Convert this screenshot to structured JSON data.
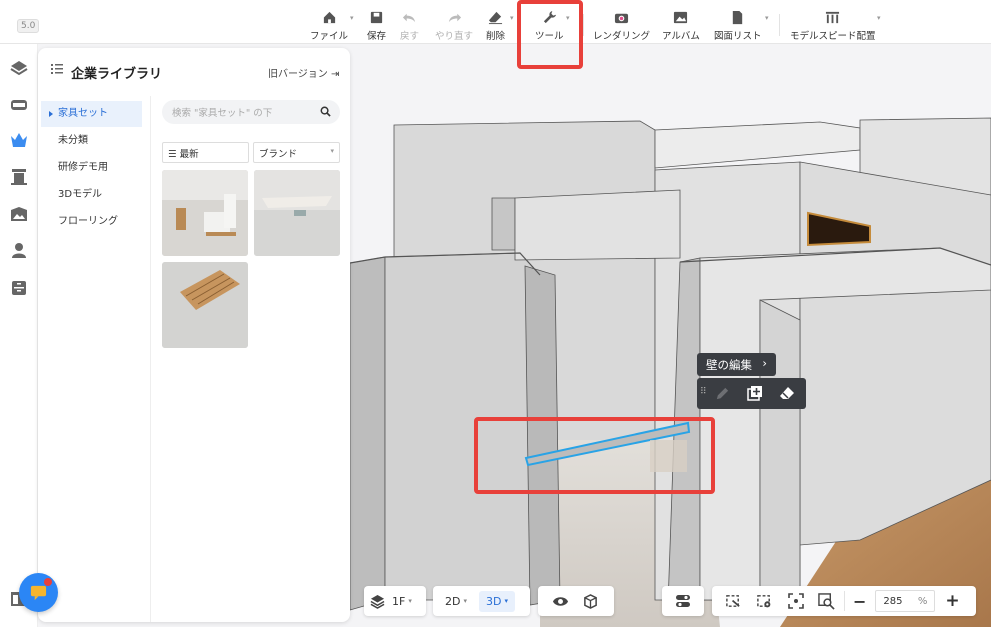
{
  "app": {
    "version": "5.0"
  },
  "toolbar": {
    "file": "ファイル",
    "save": "保存",
    "undo": "戻す",
    "redo": "やり直す",
    "delete": "削除",
    "tools": "ツール",
    "rendering": "レンダリング",
    "album": "アルバム",
    "drawing_list": "図面リスト",
    "model_speed": "モデルスピード配置"
  },
  "sidebar": {
    "icons": [
      "floorplan-icon",
      "furniture-icon",
      "enterprise-crown-icon",
      "building-icon",
      "landscape-icon",
      "user-icon",
      "cabinet-icon"
    ]
  },
  "library": {
    "title": "企業ライブラリ",
    "old_version": "旧バージョン",
    "categories": [
      "家具セット",
      "未分類",
      "研修デモ用",
      "3Dモデル",
      "フローリング"
    ],
    "active_category": 0,
    "search_placeholder": "検索 \"家具セット\" の下",
    "sort_label": "最新",
    "brand_label": "ブランド"
  },
  "context": {
    "wall_edit": "壁の編集"
  },
  "bottombar": {
    "floor": "1F",
    "view2d": "2D",
    "view3d": "3D",
    "zoom": "285",
    "zoom_unit": "%"
  },
  "colors": {
    "accent": "#2a6fd6",
    "highlight": "#e8403a",
    "selection": "#29a3e6"
  }
}
